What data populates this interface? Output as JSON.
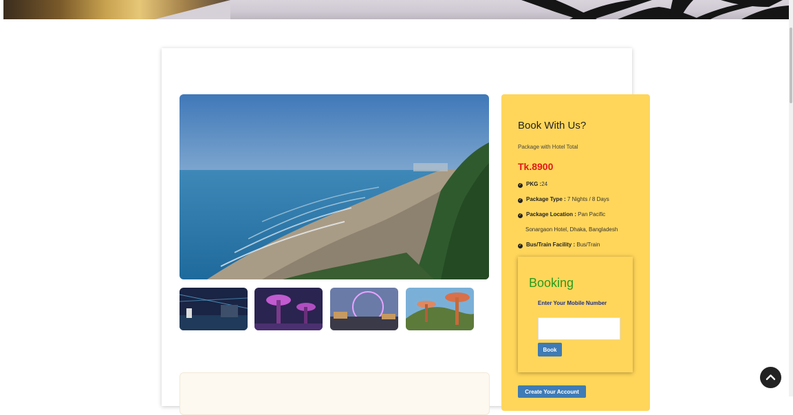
{
  "booking_panel": {
    "title": "Book With Us?",
    "package_total_label": "Package with Hotel Total",
    "price": "Tk.8900",
    "features": [
      {
        "label": "PKG :",
        "value": "24"
      },
      {
        "label": "Package Type :",
        "value": "7 Nights / 8 Days"
      },
      {
        "label": "Package Location :",
        "value": "Pan Pacific"
      },
      {
        "label": "Bus/Train Facility :",
        "value": "Bus/Train"
      }
    ],
    "location_continuation": "Sonargaon Hotel, Dhaka, Bangladesh",
    "booking_form": {
      "title": "Booking",
      "mobile_label": "Enter Your Mobile Number",
      "mobile_value": "",
      "book_button": "Book"
    },
    "create_account_button": "Create Your Account"
  },
  "icons": {
    "check": "check-circle-icon",
    "scroll_top": "chevron-up-icon"
  },
  "colors": {
    "panel_bg": "#ffd65a",
    "price": "#e11919",
    "booking_title": "#2a9a1d",
    "button": "#3f7bb5"
  }
}
